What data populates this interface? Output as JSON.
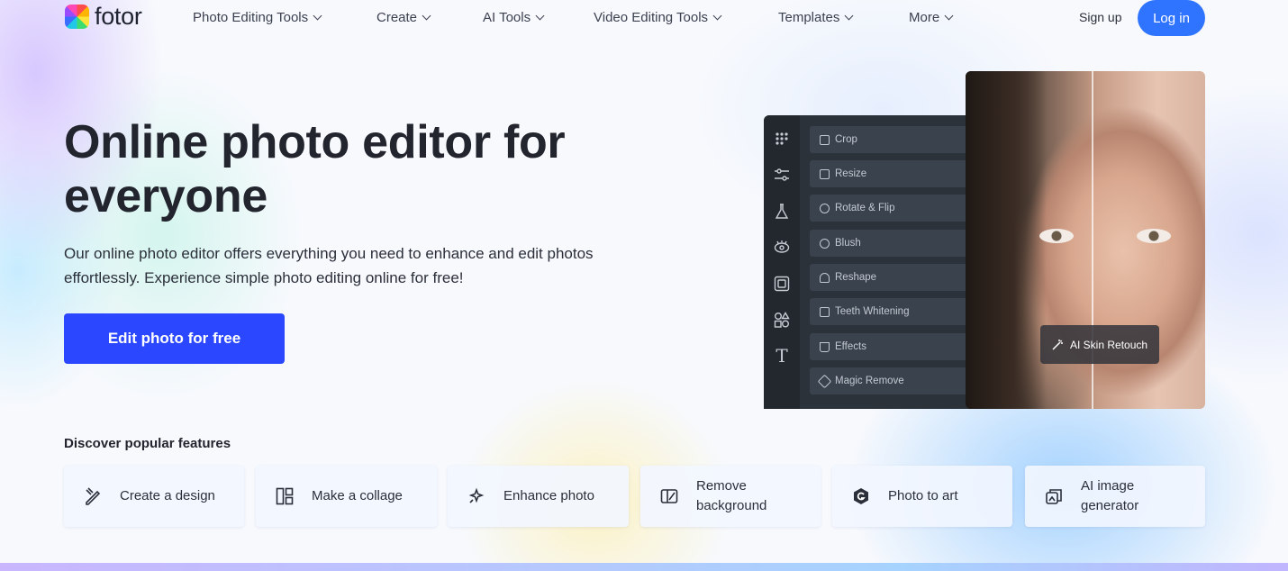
{
  "brand": {
    "name": "fotor"
  },
  "nav": {
    "items": [
      {
        "label": "Photo Editing Tools"
      },
      {
        "label": "Create"
      },
      {
        "label": "AI Tools"
      },
      {
        "label": "Video Editing Tools"
      },
      {
        "label": "Templates"
      },
      {
        "label": "More"
      }
    ],
    "signup": "Sign up",
    "login": "Log in"
  },
  "hero": {
    "title": "Online photo editor for everyone",
    "subtitle": "Our online photo editor offers everything you need to enhance and edit photos effortlessly. Experience simple photo editing online for free!",
    "cta": "Edit photo for free"
  },
  "editor": {
    "tools": [
      "Crop",
      "Resize",
      "Rotate & Flip",
      "Blush",
      "Reshape",
      "Teeth Whitening",
      "Effects",
      "Magic Remove"
    ],
    "badge": "AI Skin Retouch"
  },
  "features": {
    "heading": "Discover popular features",
    "cards": [
      {
        "label": "Create a design",
        "icon": "design-icon"
      },
      {
        "label": "Make a collage",
        "icon": "collage-icon"
      },
      {
        "label": "Enhance photo",
        "icon": "enhance-icon"
      },
      {
        "label": "Remove background",
        "icon": "remove-bg-icon"
      },
      {
        "label": "Photo to art",
        "icon": "art-icon"
      },
      {
        "label": "AI image generator",
        "icon": "ai-generator-icon"
      }
    ]
  },
  "colors": {
    "accent": "#2f74ff",
    "cta": "#2b47ff"
  }
}
